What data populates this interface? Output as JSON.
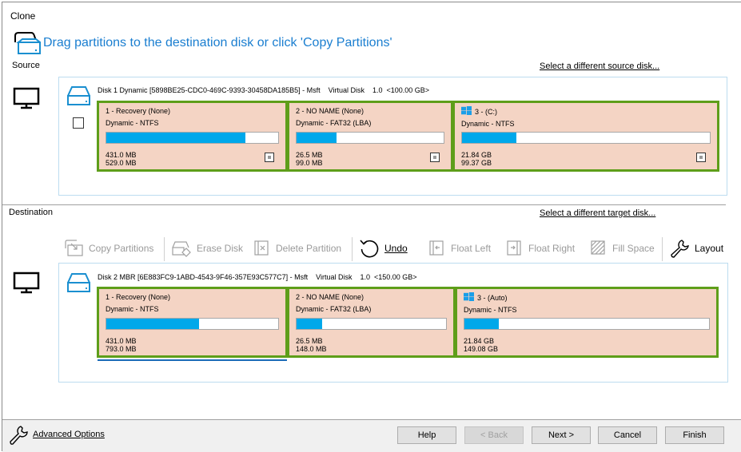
{
  "window": {
    "title": "Clone"
  },
  "header": {
    "instruction": "Drag partitions to the destination disk or click 'Copy Partitions'"
  },
  "source": {
    "label": "Source",
    "select_link": "Select a different source disk...",
    "disk_title": "Disk 1 Dynamic [5898BE25-CDC0-469C-9393-30458DA185B5] - Msft    Virtual Disk    1.0  <100.00 GB>",
    "partitions": [
      {
        "name": "1 - Recovery (None)",
        "type": "Dynamic - NTFS",
        "used": "431.0 MB",
        "total": "529.0 MB",
        "used_fraction": 0.81,
        "windows_icon": false
      },
      {
        "name": "2 - NO NAME (None)",
        "type": "Dynamic - FAT32 (LBA)",
        "used": "26.5 MB",
        "total": "99.0 MB",
        "used_fraction": 0.27,
        "windows_icon": false
      },
      {
        "name": "3 -  (C:)",
        "type": "Dynamic - NTFS",
        "used": "21.84 GB",
        "total": "99.37 GB",
        "used_fraction": 0.22,
        "windows_icon": true
      }
    ]
  },
  "destination": {
    "label": "Destination",
    "select_link": "Select a different target disk...",
    "disk_title": "Disk 2 MBR [6E883FC9-1ABD-4543-9F46-357E93C577C7] - Msft    Virtual Disk    1.0  <150.00 GB>",
    "partitions": [
      {
        "name": "1 - Recovery (None)",
        "type": "Dynamic - NTFS",
        "used": "431.0 MB",
        "total": "793.0 MB",
        "used_fraction": 0.54,
        "windows_icon": false
      },
      {
        "name": "2 - NO NAME (None)",
        "type": "Dynamic - FAT32 (LBA)",
        "used": "26.5 MB",
        "total": "148.0 MB",
        "used_fraction": 0.17,
        "windows_icon": false
      },
      {
        "name": "3 -  (Auto)",
        "type": "Dynamic - NTFS",
        "used": "21.84 GB",
        "total": "149.08 GB",
        "used_fraction": 0.14,
        "windows_icon": true
      }
    ]
  },
  "toolbar": {
    "copy_partitions": "Copy Partitions",
    "erase_disk": "Erase Disk",
    "delete_partition": "Delete Partition",
    "undo": "Undo",
    "float_left": "Float Left",
    "float_right": "Float Right",
    "fill_space": "Fill Space",
    "layout": "Layout"
  },
  "footer": {
    "advanced_options": "Advanced Options",
    "help": "Help",
    "back": "< Back",
    "next": "Next >",
    "cancel": "Cancel",
    "finish": "Finish"
  },
  "colors": {
    "accent": "#1a7ed0",
    "partition_bg": "#f4d4c4",
    "partition_border": "#5e9e1a",
    "usage_fill": "#00a8ea"
  }
}
